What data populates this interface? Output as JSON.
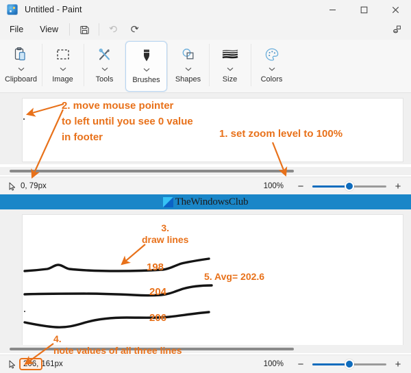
{
  "window": {
    "title": "Untitled - Paint",
    "app_icon": "paint-palette-icon",
    "controls": {
      "minimize": "minimize-icon",
      "maximize": "maximize-icon",
      "close": "close-icon"
    }
  },
  "menubar": {
    "items": [
      {
        "label": "File"
      },
      {
        "label": "View"
      }
    ],
    "icons": [
      {
        "name": "save-icon"
      },
      {
        "name": "undo-icon"
      },
      {
        "name": "redo-icon"
      }
    ],
    "right_icon": "copilot-icon"
  },
  "ribbon": {
    "groups": [
      {
        "label": "Clipboard",
        "icon": "clipboard-icon",
        "selected": false
      },
      {
        "label": "Image",
        "icon": "image-select-icon",
        "selected": false
      },
      {
        "label": "Tools",
        "icon": "tools-pencil-brush-icon",
        "selected": false
      },
      {
        "label": "Brushes",
        "icon": "brush-icon",
        "selected": true
      },
      {
        "label": "Shapes",
        "icon": "shapes-icon",
        "selected": false
      },
      {
        "label": "Size",
        "icon": "size-lines-icon",
        "selected": false
      },
      {
        "label": "Colors",
        "icon": "color-palette-icon",
        "selected": false
      }
    ]
  },
  "top_pane": {
    "status": {
      "cursor_icon": "cursor-pointer-icon",
      "coordinates": "0, 79px",
      "zoom_percent": "100%",
      "zoom_out": "−",
      "zoom_in": "+"
    },
    "annotations": [
      {
        "id": "anno-2",
        "text": "2. move mouse pointer\nto left until you see 0 value\nin footer"
      },
      {
        "id": "anno-1",
        "text": "1. set zoom level to 100%"
      }
    ]
  },
  "watermark": {
    "text": "TheWindowsClub",
    "logo": "windows-club-logo"
  },
  "bottom_pane": {
    "status": {
      "cursor_icon": "cursor-pointer-icon",
      "coordinates_highlight": "206,",
      "coordinates_rest": "161px",
      "zoom_percent": "100%",
      "zoom_out": "−",
      "zoom_in": "+"
    },
    "annotations": [
      {
        "id": "anno-3",
        "text": "3.\ndraw lines"
      },
      {
        "id": "anno-5",
        "text": "5. Avg= 202.6"
      },
      {
        "id": "anno-4",
        "text": "4.\nnote values of all three lines"
      }
    ],
    "line_values": [
      {
        "label": "198"
      },
      {
        "label": "204"
      },
      {
        "label": "206"
      }
    ]
  },
  "colors": {
    "accent_orange": "#e8711a",
    "accent_blue": "#0f6cbd",
    "watermark_band": "#1a86c8",
    "chrome": "#f3f3f3",
    "selected_outline": "#b9d6f2"
  }
}
